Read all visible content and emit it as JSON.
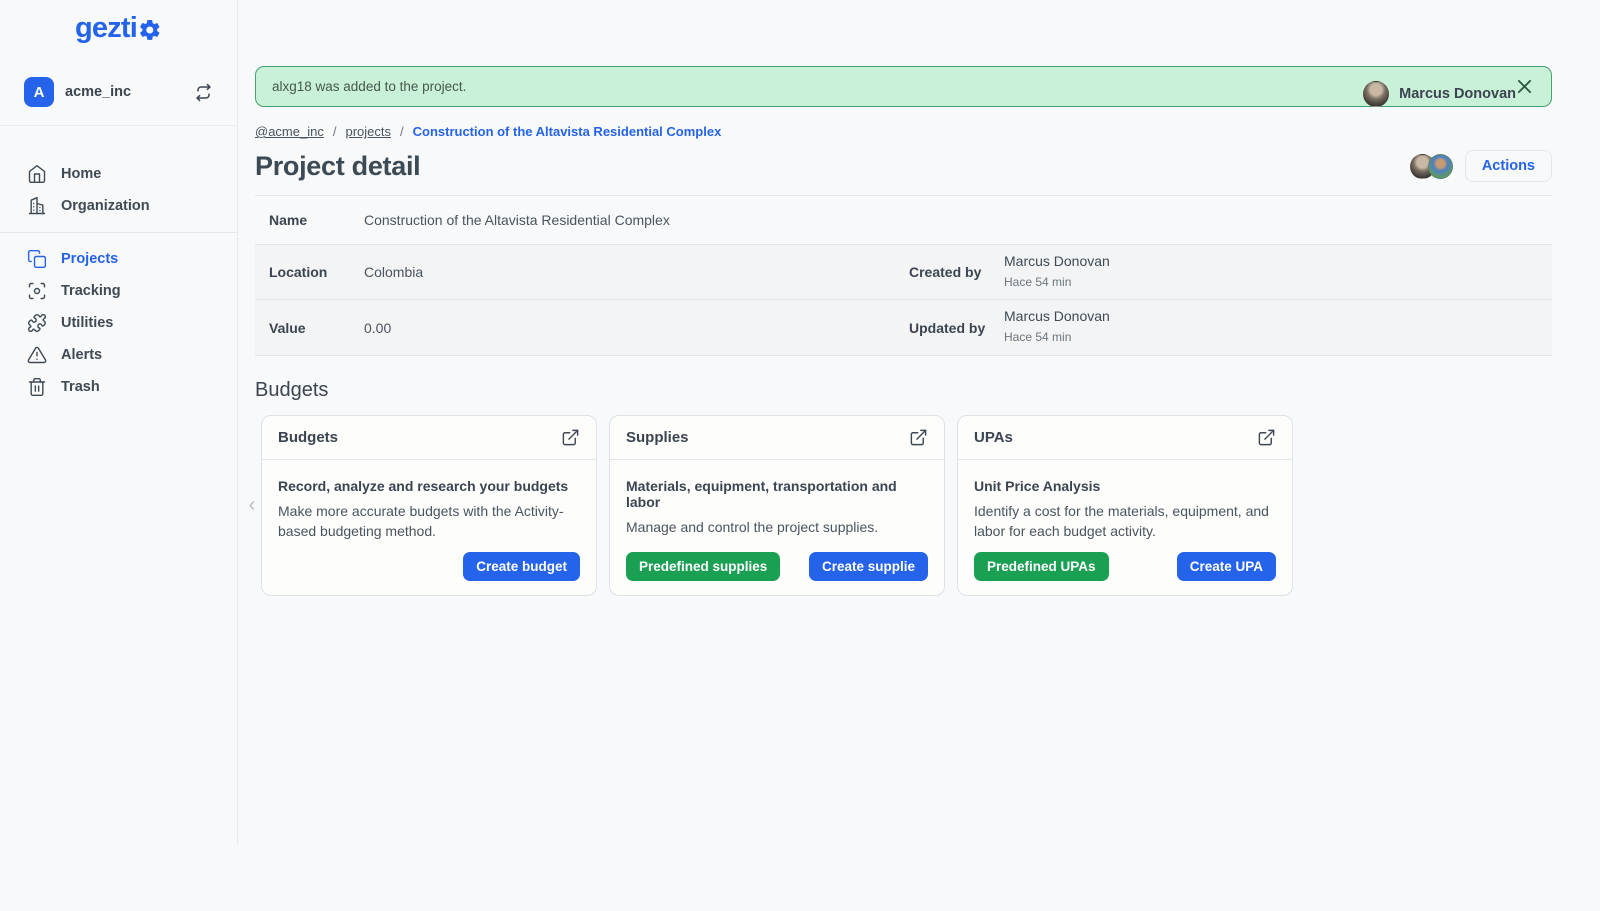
{
  "app": {
    "logo_text": "gezti",
    "user": {
      "name": "Marcus Donovan"
    }
  },
  "sidebar": {
    "org": {
      "initial": "A",
      "name": "acme_inc"
    },
    "nav": [
      {
        "label": "Home"
      },
      {
        "label": "Organization"
      },
      {
        "label": "Projects"
      },
      {
        "label": "Tracking"
      },
      {
        "label": "Utilities"
      },
      {
        "label": "Alerts"
      },
      {
        "label": "Trash"
      }
    ]
  },
  "alert": {
    "message": "alxg18 was added to the project."
  },
  "breadcrumb": {
    "org": "@acme_inc",
    "separator": "/",
    "section": "projects",
    "current": "Construction of the Altavista Residential Complex"
  },
  "page": {
    "title": "Project detail",
    "actions_label": "Actions"
  },
  "details": {
    "rows": [
      {
        "label": "Name",
        "value": "Construction of the Altavista Residential Complex"
      },
      {
        "label": "Location",
        "value": "Colombia",
        "meta_label": "Created by",
        "meta_name": "Marcus Donovan",
        "meta_time": "Hace 54 min"
      },
      {
        "label": "Value",
        "value": "0.00",
        "meta_label": "Updated by",
        "meta_name": "Marcus Donovan",
        "meta_time": "Hace 54 min"
      }
    ]
  },
  "budgets": {
    "heading": "Budgets",
    "cards": [
      {
        "title": "Budgets",
        "subtitle": "Record, analyze and research your budgets",
        "description": "Make more accurate budgets with the Activity-based budgeting method.",
        "buttons": [
          {
            "label": "Create budget",
            "style": "primary"
          }
        ]
      },
      {
        "title": "Supplies",
        "subtitle": "Materials, equipment, transportation and labor",
        "description": "Manage and control the project supplies.",
        "buttons": [
          {
            "label": "Predefined supplies",
            "style": "success"
          },
          {
            "label": "Create supplie",
            "style": "primary"
          }
        ]
      },
      {
        "title": "UPAs",
        "subtitle": "Unit Price Analysis",
        "description": "Identify a cost for the materials, equipment, and labor for each budget activity.",
        "buttons": [
          {
            "label": "Predefined UPAs",
            "style": "success"
          },
          {
            "label": "Create UPA",
            "style": "primary"
          }
        ]
      }
    ]
  },
  "colors": {
    "accent_blue": "#2563eb",
    "success_green": "#1aa053",
    "alert_bg": "#c9f1d8",
    "alert_border": "#46a071",
    "page_bg": "#f8f9fa"
  }
}
